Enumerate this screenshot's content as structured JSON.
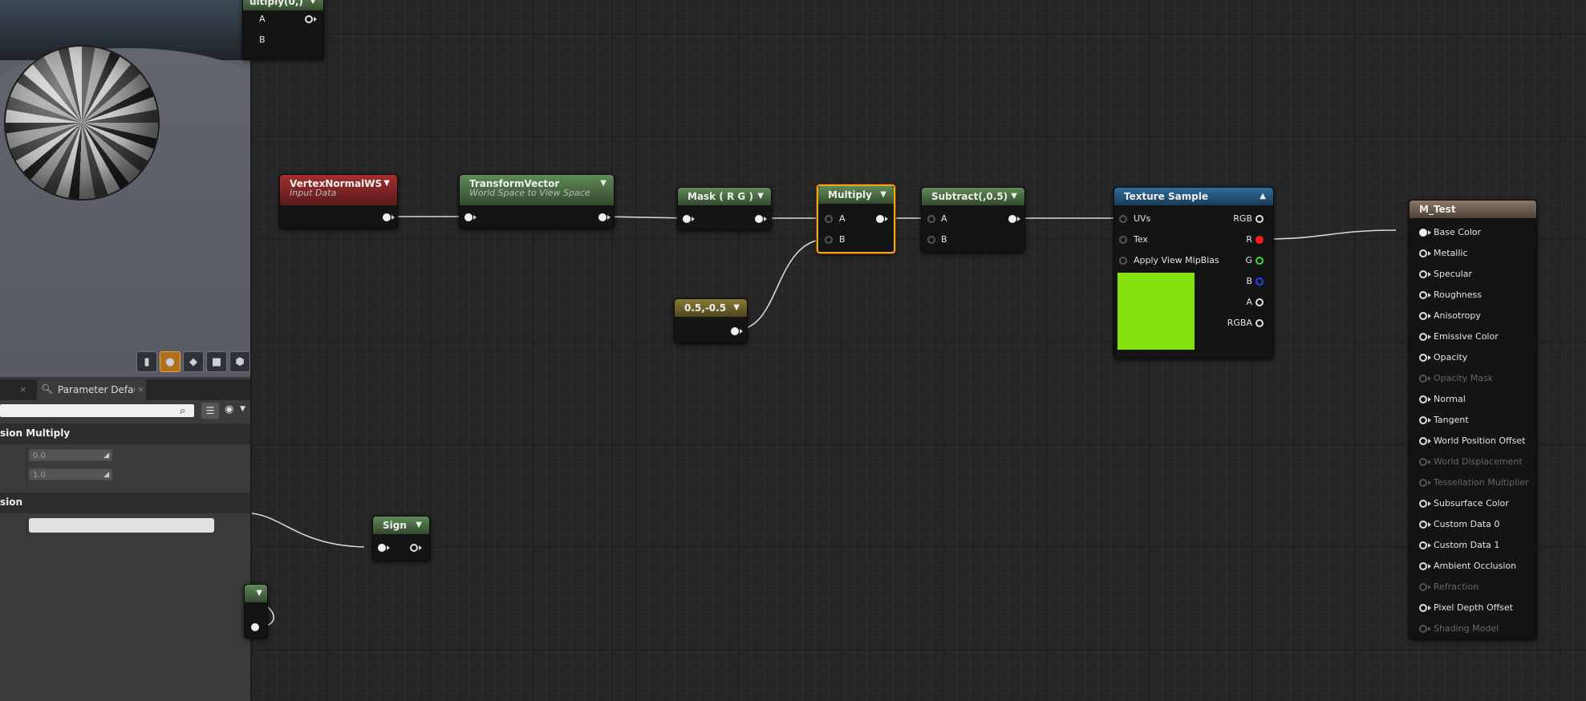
{
  "panel": {
    "tab_label": "Parameter Defaults",
    "tab_close": "×",
    "prev_tab_close": "×",
    "category1": "sion Multiply",
    "const_a": "0.0",
    "const_b": "1.0",
    "category2": "sion"
  },
  "viewport": {
    "buttons": [
      "cylinder-icon",
      "sphere-icon",
      "plane-icon",
      "cube-icon",
      "custom-mesh-icon"
    ],
    "active_button": 1
  },
  "graph": {
    "multiply_top": {
      "title": "ultiply(0,)",
      "inputs": [
        "A",
        "B"
      ]
    },
    "vertex_normal": {
      "title": "VertexNormalWS",
      "subtitle": "Input Data"
    },
    "transform_vector": {
      "title": "TransformVector",
      "subtitle": "World Space to View Space"
    },
    "mask": {
      "title": "Mask ( R G )"
    },
    "multiply": {
      "title": "Multiply",
      "inputs": [
        "A",
        "B"
      ]
    },
    "subtract": {
      "title": "Subtract(,0.5)",
      "inputs": [
        "A",
        "B"
      ]
    },
    "constant": {
      "title": "0.5,-0.5"
    },
    "texture_sample": {
      "title": "Texture Sample",
      "inputs": [
        "UVs",
        "Tex",
        "Apply View MipBias"
      ],
      "outputs": [
        "RGB",
        "R",
        "G",
        "B",
        "A",
        "RGBA"
      ],
      "preview_color": "#84e10b"
    },
    "sign": {
      "title": "Sign"
    },
    "material": {
      "title": "M_Test",
      "pins": [
        {
          "label": "Base Color",
          "enabled": true
        },
        {
          "label": "Metallic",
          "enabled": true
        },
        {
          "label": "Specular",
          "enabled": true
        },
        {
          "label": "Roughness",
          "enabled": true
        },
        {
          "label": "Anisotropy",
          "enabled": true
        },
        {
          "label": "Emissive Color",
          "enabled": true
        },
        {
          "label": "Opacity",
          "enabled": true
        },
        {
          "label": "Opacity Mask",
          "enabled": false
        },
        {
          "label": "Normal",
          "enabled": true
        },
        {
          "label": "Tangent",
          "enabled": true
        },
        {
          "label": "World Position Offset",
          "enabled": true
        },
        {
          "label": "World Displacement",
          "enabled": false
        },
        {
          "label": "Tessellation Multiplier",
          "enabled": false
        },
        {
          "label": "Subsurface Color",
          "enabled": true
        },
        {
          "label": "Custom Data 0",
          "enabled": true
        },
        {
          "label": "Custom Data 1",
          "enabled": true
        },
        {
          "label": "Ambient Occlusion",
          "enabled": true
        },
        {
          "label": "Refraction",
          "enabled": false
        },
        {
          "label": "Pixel Depth Offset",
          "enabled": true
        },
        {
          "label": "Shading Model",
          "enabled": false
        }
      ]
    }
  }
}
